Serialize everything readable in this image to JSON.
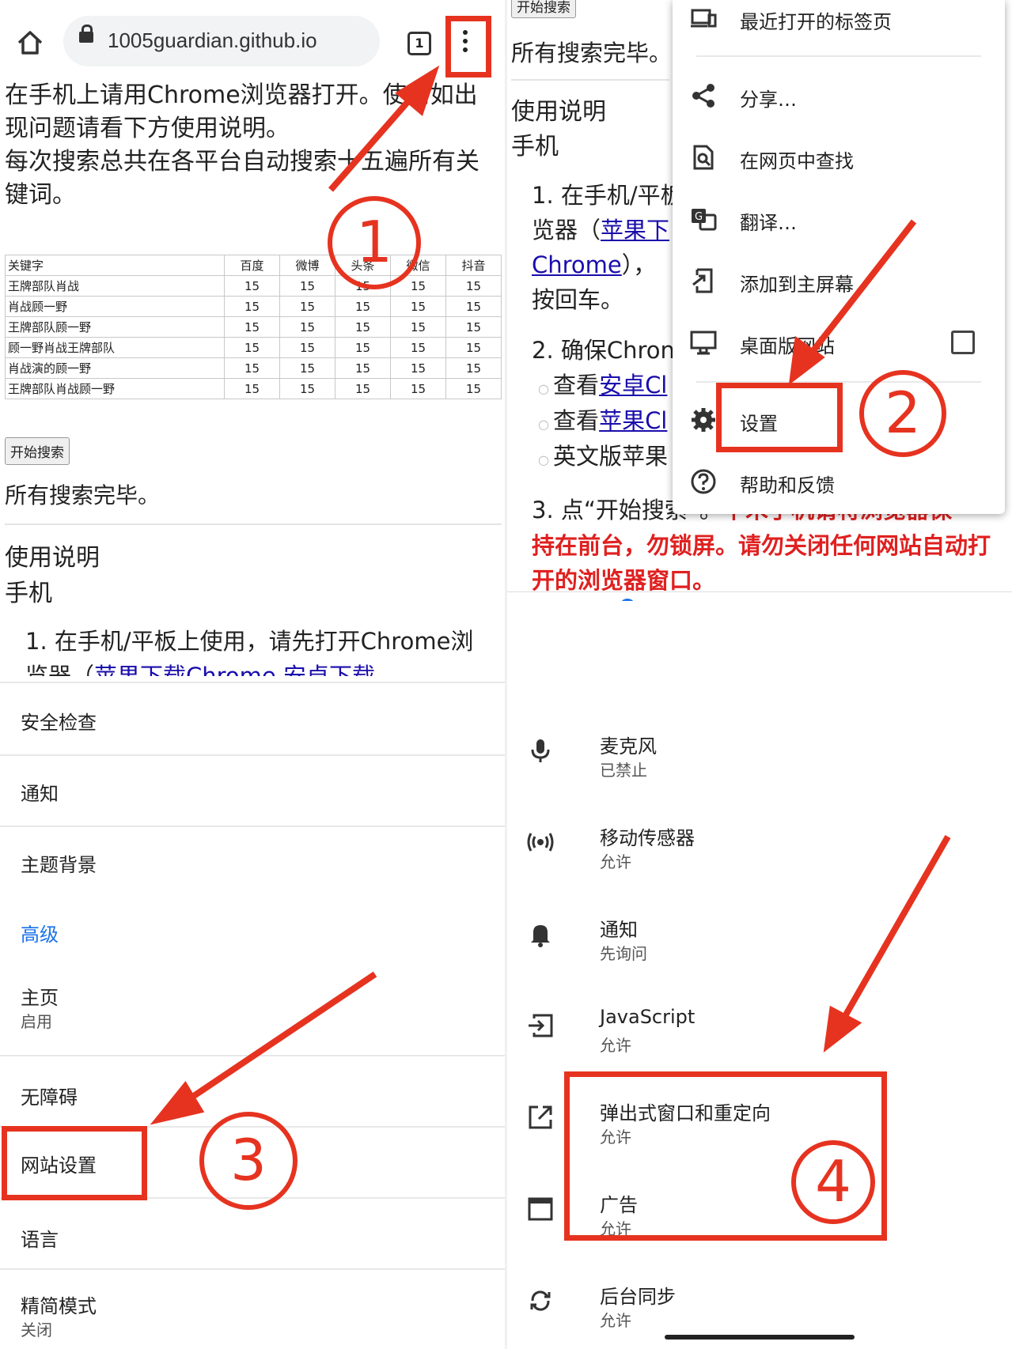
{
  "browser": {
    "url": "1005guardian.github.io",
    "tab_count": "1",
    "intro_line1": "在手机上请用Chrome浏览器打开。使用如出现问题请看下方使用说明。",
    "intro_line2": "每次搜索总共在各平台自动搜索十五遍所有关键词。",
    "table": {
      "headers": [
        "关键字",
        "百度",
        "微博",
        "头条",
        "微信",
        "抖音"
      ],
      "rows": [
        [
          "王牌部队肖战",
          "15",
          "15",
          "15",
          "15",
          "15"
        ],
        [
          "肖战顾一野",
          "15",
          "15",
          "15",
          "15",
          "15"
        ],
        [
          "王牌部队顾一野",
          "15",
          "15",
          "15",
          "15",
          "15"
        ],
        [
          "顾一野肖战王牌部队",
          "15",
          "15",
          "15",
          "15",
          "15"
        ],
        [
          "肖战演的顾一野",
          "15",
          "15",
          "15",
          "15",
          "15"
        ],
        [
          "王牌部队肖战顾一野",
          "15",
          "15",
          "15",
          "15",
          "15"
        ]
      ]
    },
    "start_button": "开始搜索",
    "done_text": "所有搜索完毕。",
    "usage_title": "使用说明",
    "usage_sub": "手机",
    "step1_a": "1. 在手机/平板上使用，请先打开Chrome浏",
    "step1_b_prefix": "览器（",
    "step1_b_link": "苹果下载Chrome 安卓下载"
  },
  "menu_panel": {
    "top_button": "开始搜索",
    "done_text": "所有搜索完毕。",
    "usage_title": "使用说明",
    "usage_sub": "手机",
    "step1_a": "1. 在手机/平板",
    "step1_b_prefix": "览器（",
    "step1_b_link": "苹果下",
    "step1_c_link": "Chrome",
    "step1_c_rest": "），",
    "step1_d": "按回车。",
    "step2": "2. 确保Chron",
    "bullet1_prefix": "查看",
    "bullet1_link": "安卓Cl",
    "bullet2_prefix": "查看",
    "bullet2_link": "苹果Cl",
    "bullet3": "英文版苹果",
    "step3": "3. 点“开始搜索”。",
    "step3_red_tail": "千禾手机请将浏览器保",
    "warning": "持在前台，勿锁屏。请勿关闭任何网站自动打开的浏览器窗口。",
    "items": [
      {
        "label": "最近打开的标签页",
        "icon": "recent-tabs-icon"
      },
      {
        "label": "分享…",
        "icon": "share-icon"
      },
      {
        "label": "在网页中查找",
        "icon": "find-in-page-icon"
      },
      {
        "label": "翻译…",
        "icon": "translate-icon"
      },
      {
        "label": "添加到主屏幕",
        "icon": "add-to-home-icon"
      },
      {
        "label": "桌面版网站",
        "icon": "desktop-icon"
      },
      {
        "label": "设置",
        "icon": "gear-icon"
      },
      {
        "label": "帮助和反馈",
        "icon": "help-icon"
      }
    ]
  },
  "settings": {
    "items": [
      {
        "title": "安全检查"
      },
      {
        "title": "通知"
      },
      {
        "title": "主题背景"
      },
      {
        "title": "高级"
      },
      {
        "title": "主页",
        "sub": "启用"
      },
      {
        "title": "无障碍"
      },
      {
        "title": "网站设置"
      },
      {
        "title": "语言"
      },
      {
        "title": "精简模式",
        "sub": "关闭"
      }
    ]
  },
  "site_settings": {
    "items": [
      {
        "title": "麦克风",
        "sub": "已禁止",
        "icon": "microphone-icon"
      },
      {
        "title": "移动传感器",
        "sub": "允许",
        "icon": "motion-sensor-icon"
      },
      {
        "title": "通知",
        "sub": "先询问",
        "icon": "bell-icon"
      },
      {
        "title": "JavaScript",
        "sub": "允许",
        "icon": "javascript-icon"
      },
      {
        "title": "弹出式窗口和重定向",
        "sub": "允许",
        "icon": "popup-icon"
      },
      {
        "title": "广告",
        "sub": "允许",
        "icon": "ads-icon"
      },
      {
        "title": "后台同步",
        "sub": "允许",
        "icon": "sync-icon"
      }
    ]
  },
  "annotations": {
    "n1": "1",
    "n2": "2",
    "n3": "3",
    "n4": "4",
    "color": "#e63320"
  },
  "colors": {
    "link": "#1a0dab",
    "accent": "#1a73e8",
    "warning": "#e02020"
  }
}
